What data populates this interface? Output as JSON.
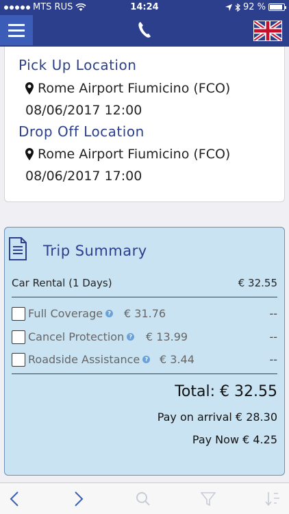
{
  "status_bar": {
    "carrier": "MTS RUS",
    "time": "14:24",
    "battery": "92 %"
  },
  "nav": {
    "menu_icon": "hamburger-icon",
    "phone_icon": "phone-icon",
    "flag_icon": "uk-flag-icon"
  },
  "pickup": {
    "title": "Pick Up Location",
    "place": "Rome Airport Fiumicino (FCO)",
    "datetime": "08/06/2017 12:00"
  },
  "dropoff": {
    "title": "Drop Off Location",
    "place": "Rome Airport Fiumicino (FCO)",
    "datetime": "08/06/2017 17:00"
  },
  "summary": {
    "title": "Trip Summary",
    "rental_label": "Car Rental (1 Days)",
    "rental_price": "€ 32.55",
    "options": [
      {
        "label": "Full Coverage",
        "price": "€ 31.76",
        "selected_price": "--",
        "checked": false
      },
      {
        "label": "Cancel Protection",
        "price": "€ 13.99",
        "selected_price": "--",
        "checked": false
      },
      {
        "label": "Roadside Assistance",
        "price": "€ 3.44",
        "selected_price": "--",
        "checked": false
      }
    ],
    "total": "Total: €  32.55",
    "pay_on_arrival": "Pay on arrival € 28.30",
    "pay_now": "Pay Now € 4.25"
  },
  "colors": {
    "brand": "#2b3f8c",
    "summary_bg": "#c9e3f2",
    "toolbar_icon": "#3b5db8"
  }
}
